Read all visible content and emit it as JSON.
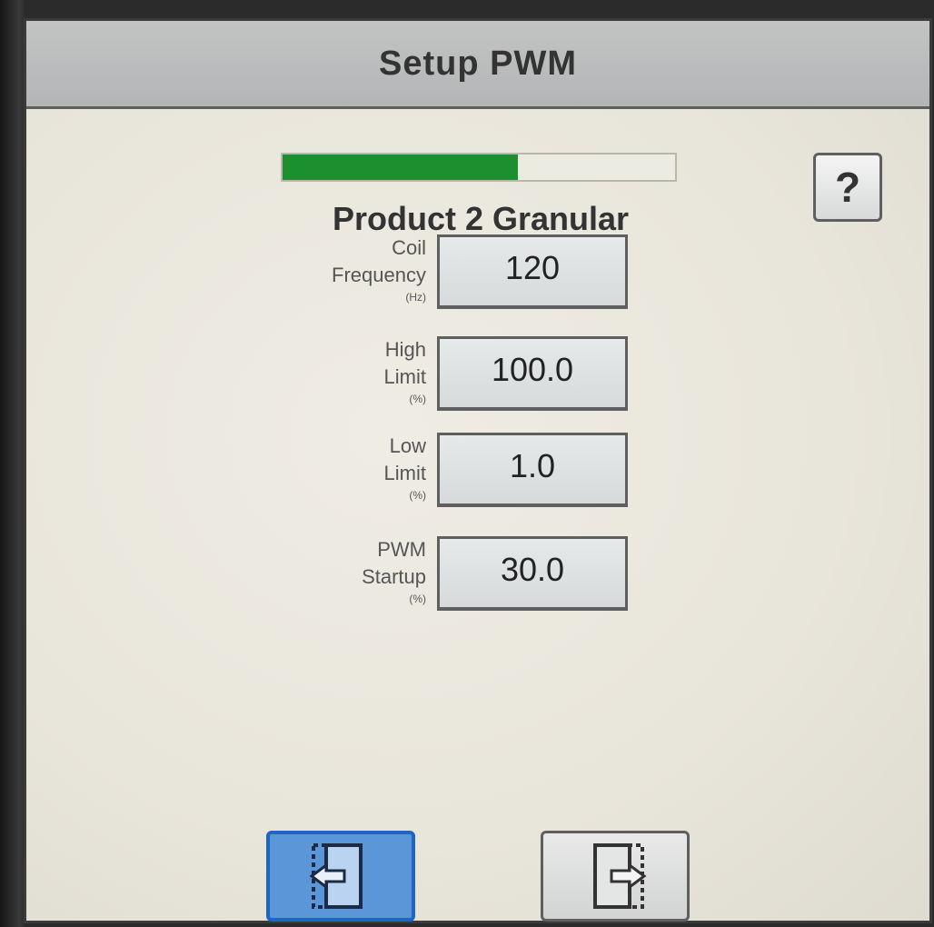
{
  "header": {
    "title": "Setup PWM"
  },
  "progress": {
    "fraction": 0.6
  },
  "help": {
    "label": "?"
  },
  "product": {
    "name": "Product 2 Granular"
  },
  "fields": [
    {
      "label_lines": [
        "Coil",
        "Frequency"
      ],
      "unit": "(Hz)",
      "value": "120"
    },
    {
      "label_lines": [
        "High",
        "Limit"
      ],
      "unit": "(%)",
      "value": "100.0"
    },
    {
      "label_lines": [
        "Low",
        "Limit"
      ],
      "unit": "(%)",
      "value": "1.0"
    },
    {
      "label_lines": [
        "PWM",
        "Startup"
      ],
      "unit": "(%)",
      "value": "30.0"
    }
  ],
  "nav": {
    "prev_icon": "previous-page-icon",
    "next_icon": "next-page-icon"
  },
  "colors": {
    "progress_fill": "#1c8f2e",
    "selected_button": "#5b97d8"
  }
}
